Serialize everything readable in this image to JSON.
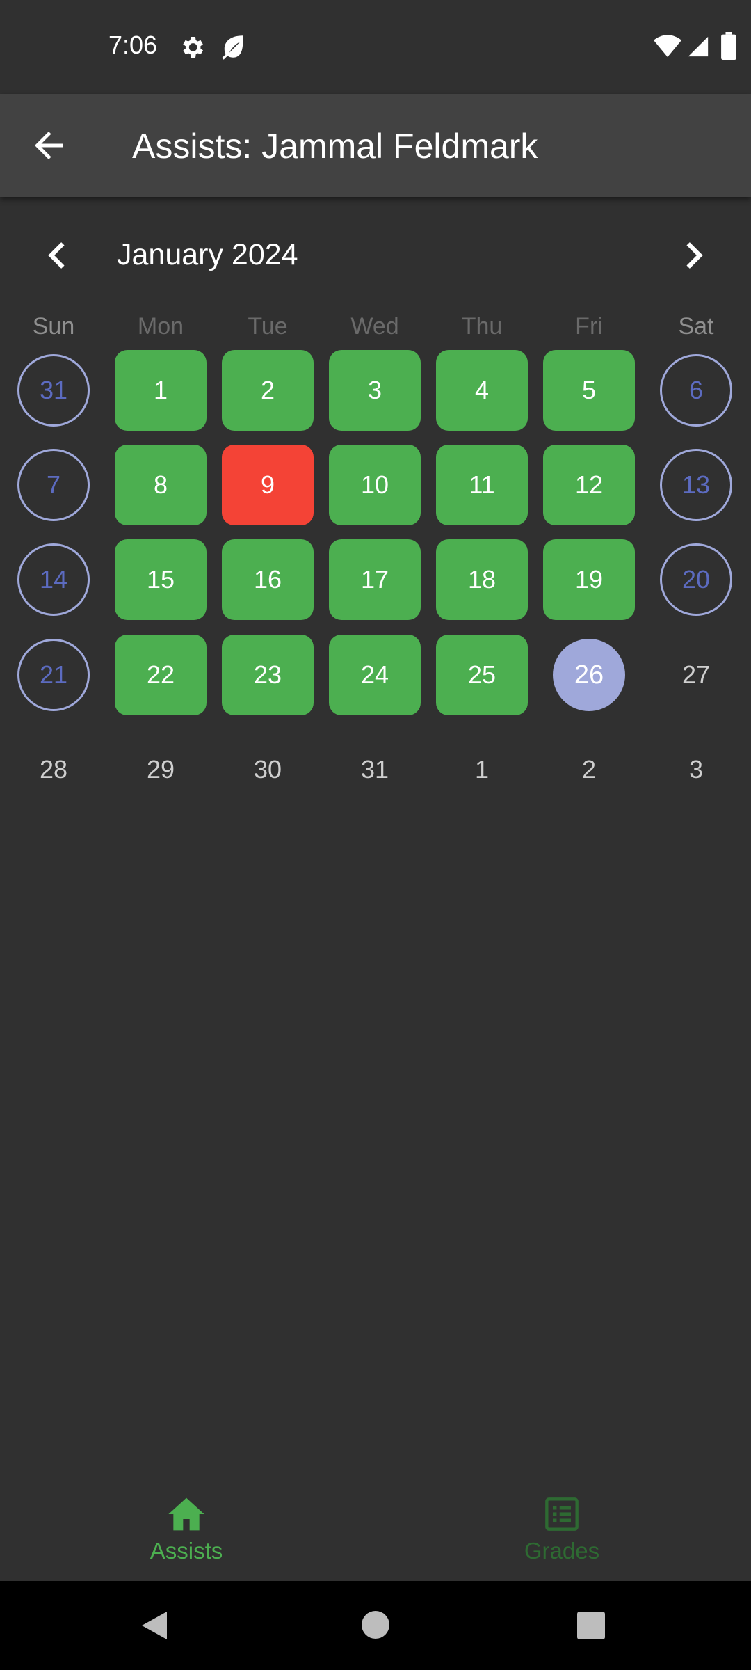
{
  "status_bar": {
    "time": "7:06"
  },
  "app_bar": {
    "title": "Assists: Jammal Feldmark"
  },
  "calendar": {
    "month_label": "January 2024",
    "weekdays": [
      "Sun",
      "Mon",
      "Tue",
      "Wed",
      "Thu",
      "Fri",
      "Sat"
    ],
    "weeks": [
      [
        {
          "label": "31",
          "status": "weekend"
        },
        {
          "label": "1",
          "status": "present"
        },
        {
          "label": "2",
          "status": "present"
        },
        {
          "label": "3",
          "status": "present"
        },
        {
          "label": "4",
          "status": "present"
        },
        {
          "label": "5",
          "status": "present"
        },
        {
          "label": "6",
          "status": "weekend"
        }
      ],
      [
        {
          "label": "7",
          "status": "weekend"
        },
        {
          "label": "8",
          "status": "present"
        },
        {
          "label": "9",
          "status": "absent"
        },
        {
          "label": "10",
          "status": "present"
        },
        {
          "label": "11",
          "status": "present"
        },
        {
          "label": "12",
          "status": "present"
        },
        {
          "label": "13",
          "status": "weekend"
        }
      ],
      [
        {
          "label": "14",
          "status": "weekend"
        },
        {
          "label": "15",
          "status": "present"
        },
        {
          "label": "16",
          "status": "present"
        },
        {
          "label": "17",
          "status": "present"
        },
        {
          "label": "18",
          "status": "present"
        },
        {
          "label": "19",
          "status": "present"
        },
        {
          "label": "20",
          "status": "weekend"
        }
      ],
      [
        {
          "label": "21",
          "status": "weekend"
        },
        {
          "label": "22",
          "status": "present"
        },
        {
          "label": "23",
          "status": "present"
        },
        {
          "label": "24",
          "status": "present"
        },
        {
          "label": "25",
          "status": "present"
        },
        {
          "label": "26",
          "status": "today"
        },
        {
          "label": "27",
          "status": "plain"
        }
      ],
      [
        {
          "label": "28",
          "status": "plain"
        },
        {
          "label": "29",
          "status": "plain"
        },
        {
          "label": "30",
          "status": "plain"
        },
        {
          "label": "31",
          "status": "plain"
        },
        {
          "label": "1",
          "status": "plain"
        },
        {
          "label": "2",
          "status": "plain"
        },
        {
          "label": "3",
          "status": "plain"
        }
      ]
    ]
  },
  "bottom_nav": {
    "items": [
      {
        "label": "Assists",
        "icon": "home-icon",
        "selected": true
      },
      {
        "label": "Grades",
        "icon": "list-icon",
        "selected": false
      }
    ]
  },
  "colors": {
    "present": "#4caf50",
    "absent": "#f44336",
    "weekend_ring": "#9fa8da",
    "today": "#9fa8da",
    "background": "#303030",
    "app_bar": "#424242"
  }
}
